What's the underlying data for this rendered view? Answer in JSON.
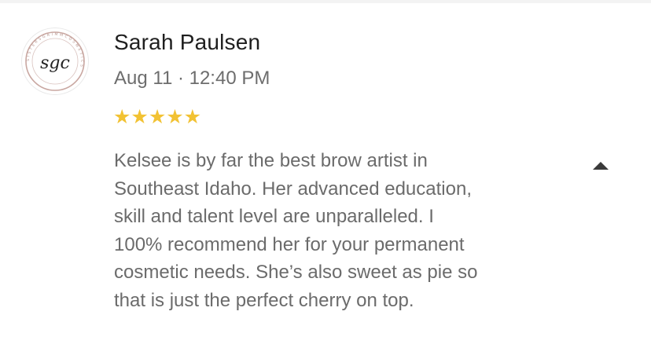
{
  "review": {
    "author": "Sarah Paulsen",
    "date": "Aug 11 · 12:40 PM",
    "rating": 5,
    "rating_max": 5,
    "stars_text": "★★★★★",
    "body_lines": [
      "Kelsee is by far the best brow artist in",
      "Southeast Idaho. Her advanced education,",
      "skill and talent level are unparalleled. I",
      "100% recommend her for your permanent",
      "cosmetic needs. She’s also sweet as pie so",
      "that is just the perfect cherry on top."
    ],
    "avatar": {
      "monogram": "sgc",
      "ring_text": "SISTERSGRIMMCOSMETICS",
      "ring_color": "#c9a7a1"
    },
    "collapse_icon": "caret-up-icon"
  },
  "colors": {
    "star": "#f2c233",
    "name": "#1f1f1f",
    "secondary_text": "#6d6d6d"
  }
}
